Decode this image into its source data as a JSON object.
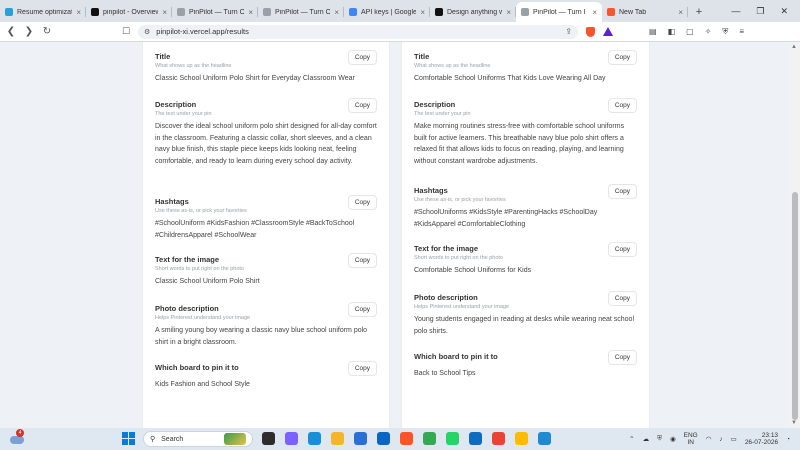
{
  "browser": {
    "tabs": [
      {
        "title": "Resume optimizatio",
        "color": "#2aa0d8"
      },
      {
        "title": "pinpilot - Overview -",
        "color": "#111111"
      },
      {
        "title": "PinPilot — Turn One",
        "color": "#9aa0a6"
      },
      {
        "title": "PinPilot — Turn One",
        "color": "#9aa0a6"
      },
      {
        "title": "API keys | Google AI",
        "color": "#4285f4"
      },
      {
        "title": "Design anything with",
        "color": "#111111"
      },
      {
        "title": "PinPilot — Turn I",
        "color": "#9aa0a6",
        "active": true
      },
      {
        "title": "New Tab",
        "color": "#fb542b"
      }
    ],
    "new_tab_symbol": "+",
    "url": "pinpilot-xi.vercel.app/results"
  },
  "left_card": {
    "fields": [
      {
        "label": "Title",
        "subtitle": "What shows up as the headline",
        "value": "Classic School Uniform Polo Shirt for Everyday Classroom Wear",
        "copy": "Copy"
      },
      {
        "label": "Description",
        "subtitle": "The text under your pin",
        "value": "Discover the ideal school uniform polo shirt designed for all-day comfort in the classroom. Featuring a classic collar, short sleeves, and a clean navy blue finish, this staple piece keeps kids looking neat, feeling comfortable, and ready to learn during every school day activity.",
        "copy": "Copy"
      },
      {
        "label": "Hashtags",
        "subtitle": "Use these as-is, or pick your favorites",
        "value": "#SchoolUniform #KidsFashion #ClassroomStyle #BackToSchool #ChildrensApparel #SchoolWear",
        "copy": "Copy"
      },
      {
        "label": "Text for the image",
        "subtitle": "Short words to put right on the photo",
        "value": "Classic School Uniform Polo Shirt",
        "copy": "Copy"
      },
      {
        "label": "Photo description",
        "subtitle": "Helps Pinterest understand your image",
        "value": "A smiling young boy wearing a classic navy blue school uniform polo shirt in a bright classroom.",
        "copy": "Copy"
      },
      {
        "label": "Which board to pin it to",
        "subtitle": "",
        "value": "Kids Fashion and School Style",
        "copy": "Copy"
      }
    ]
  },
  "right_card": {
    "fields": [
      {
        "label": "Title",
        "subtitle": "What shows up as the headline",
        "value": "Comfortable School Uniforms That Kids Love Wearing All Day",
        "copy": "Copy"
      },
      {
        "label": "Description",
        "subtitle": "The text under your pin",
        "value": "Make morning routines stress-free with comfortable school uniforms built for active learners. This breathable navy blue polo shirt offers a relaxed fit that allows kids to focus on reading, playing, and learning without constant wardrobe adjustments.",
        "copy": "Copy"
      },
      {
        "label": "Hashtags",
        "subtitle": "Use these as-is, or pick your favorites",
        "value": "#SchoolUniforms #KidsStyle #ParentingHacks #SchoolDay #KidsApparel #ComfortableClothing",
        "copy": "Copy"
      },
      {
        "label": "Text for the image",
        "subtitle": "Short words to put right on the photo",
        "value": "Comfortable School Uniforms for Kids",
        "copy": "Copy"
      },
      {
        "label": "Photo description",
        "subtitle": "Helps Pinterest understand your image",
        "value": "Young students engaged in reading at desks while wearing neat school polo shirts.",
        "copy": "Copy"
      },
      {
        "label": "Which board to pin it to",
        "subtitle": "",
        "value": "Back to School Tips",
        "copy": "Copy"
      }
    ]
  },
  "taskbar": {
    "weather_badge": "4",
    "search_placeholder": "Search",
    "lang": "ENG",
    "region": "IN",
    "time": "23:13",
    "date": "26-07-2026",
    "apps": [
      {
        "name": "task-view",
        "color": "#2d2d2d",
        "badge": ""
      },
      {
        "name": "copilot",
        "color": "#7b61ff",
        "badge": ""
      },
      {
        "name": "edge",
        "color": "#1a8fd8",
        "badge": ""
      },
      {
        "name": "file-explorer",
        "color": "#f3b52a",
        "badge": ""
      },
      {
        "name": "store",
        "color": "#2a6fd6",
        "badge": ""
      },
      {
        "name": "hp",
        "color": "#0a66c2",
        "badge": ""
      },
      {
        "name": "brave",
        "color": "#fb542b",
        "badge": ""
      },
      {
        "name": "chrome",
        "color": "#34a853",
        "badge": ""
      },
      {
        "name": "whatsapp",
        "color": "#25d366",
        "badge": ""
      },
      {
        "name": "outlook",
        "color": "#0f6cbd",
        "badge": ""
      },
      {
        "name": "chrome-profile",
        "color": "#ea4335",
        "badge": ""
      },
      {
        "name": "chrome-profile-2",
        "color": "#fbbc04",
        "badge": ""
      },
      {
        "name": "vscode",
        "color": "#1f8ad2",
        "badge": ""
      }
    ]
  }
}
